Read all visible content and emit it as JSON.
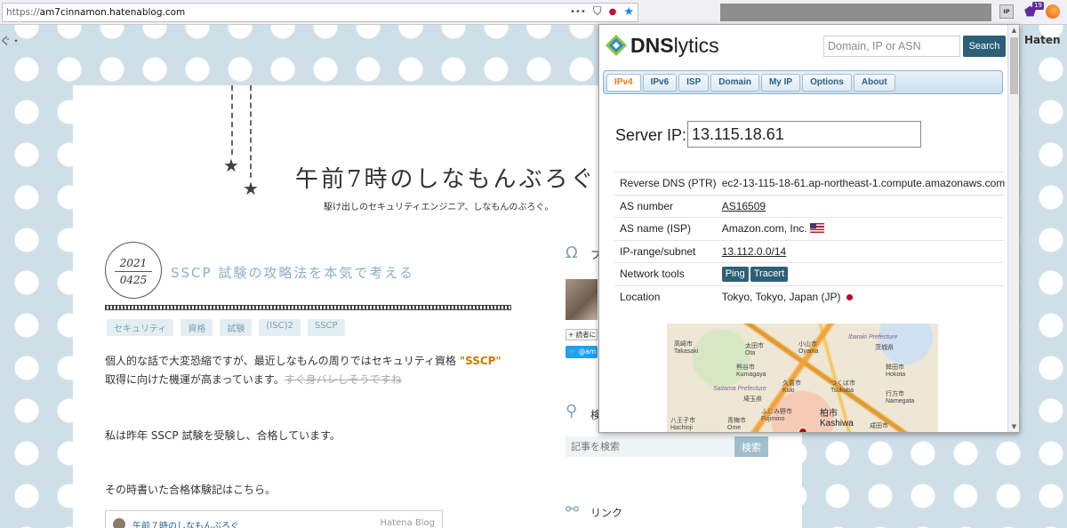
{
  "browser": {
    "url_prefix": "https://",
    "url_host": "am7cinnamon.hatenablog.com",
    "menu_glyph": "•••",
    "ext_ip_label": "IP",
    "ext_badge": "19",
    "left_edge_text": "ぐ・",
    "right_edge_text": "Haten"
  },
  "blog": {
    "title": "午前7時のしなもんぶろぐ",
    "subtitle": "駆け出しのセキュリティエンジニア、しなもんのぶろぐ。",
    "date_year": "2021",
    "date_day": "0425",
    "entry_title": "SSCP 試験の攻略法を本気で考える",
    "tags": [
      "セキュリティ",
      "資格",
      "試験",
      "(ISC)2",
      "SSCP"
    ],
    "para1_before": "個人的な話で大変恐縮ですが、最近しなもんの周りではセキュリティ資格 ",
    "para1_highlight": "\"SSCP\"",
    "para1_after": " 取得に向けた機運が高まっています。",
    "para1_strike": "すぐ身バレしそうですね",
    "para2": "私は昨年 SSCP 試験を受験し、合格しています。",
    "para3": "その時書いた合格体験記はこちら。",
    "embed_title": "午前７時のしなもんぶろぐ",
    "embed_logo": "Hatena Blog",
    "sidebar": {
      "profile_heading_fragment": "プ",
      "reader_button": "読者に",
      "twitter_button": "@am",
      "search_heading_fragment": "検",
      "search_placeholder": "記事を検索",
      "search_button": "検索",
      "links_heading": "リンク"
    }
  },
  "dnslytics": {
    "brand_prefix": "DNS",
    "brand_suffix": "lytics",
    "search_placeholder": "Domain, IP or ASN",
    "search_button": "Search",
    "tabs": [
      "IPv4",
      "IPv6",
      "ISP",
      "Domain",
      "My IP",
      "Options",
      "About"
    ],
    "active_tab": "IPv4",
    "server_label": "Server IP:",
    "server_ip": "13.115.18.61",
    "rows": {
      "reverse_dns": {
        "label": "Reverse DNS (PTR)",
        "value": "ec2-13-115-18-61.ap-northeast-1.compute.amazonaws.com"
      },
      "as_number": {
        "label": "AS number",
        "value": "AS16509"
      },
      "as_name": {
        "label": "AS name (ISP)",
        "value": "Amazon.com, Inc."
      },
      "ip_range": {
        "label": "IP-range/subnet",
        "value": "13.112.0.0/14"
      },
      "network_tools": {
        "label": "Network tools",
        "ping": "Ping",
        "tracert": "Tracert"
      },
      "location": {
        "label": "Location",
        "value": "Tokyo, Tokyo, Japan (JP)"
      }
    },
    "map_labels": {
      "takasaki": "高崎市\nTakasaki",
      "ota": "太田市\nOta",
      "oyama": "小山市\nOyama",
      "ibaraki": "Ibaraki Prefecture",
      "ibaraki_jp": "茨城県",
      "hitachinaka": "鉾田市\nHokota",
      "kumagaya": "熊谷市\nKumagaya",
      "kuki": "久喜市\nKuki",
      "tsukuba": "つくば市\nTsukuba",
      "saitama": "Saitama Prefecture",
      "saitama_jp": "埼玉県",
      "namegata": "行方市\nNamegata",
      "kashiwa": "柏市\nKashiwa",
      "fujimino": "ふじみ野市\nFujimino",
      "ome": "青梅市\nOme",
      "narita": "成田市",
      "hachioji": "八王子市\nHachioji"
    }
  }
}
